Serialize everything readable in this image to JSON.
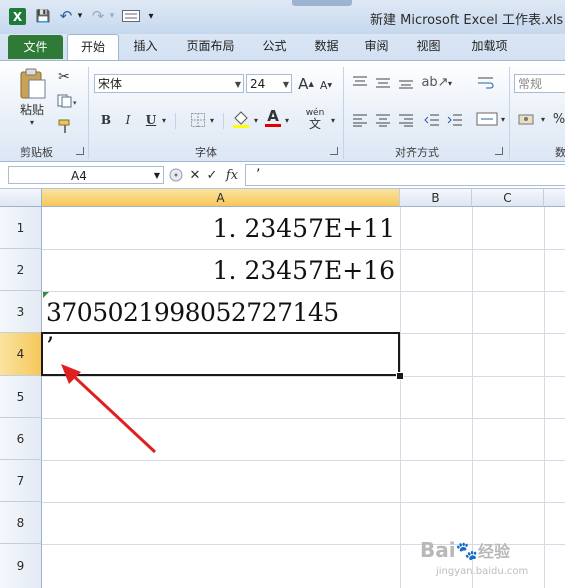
{
  "window": {
    "title": "新建 Microsoft Excel 工作表.xls  [兼",
    "app_icon": "X"
  },
  "quick_access": {
    "save_icon": "💾",
    "undo_icon": "↶",
    "redo_icon": "↷",
    "customize_icon": "▾"
  },
  "tabs": [
    {
      "label": "文件"
    },
    {
      "label": "开始"
    },
    {
      "label": "插入"
    },
    {
      "label": "页面布局"
    },
    {
      "label": "公式"
    },
    {
      "label": "数据"
    },
    {
      "label": "审阅"
    },
    {
      "label": "视图"
    },
    {
      "label": "加载项"
    }
  ],
  "ribbon": {
    "clipboard": {
      "label": "剪贴板",
      "paste_label": "粘贴"
    },
    "font": {
      "label": "字体",
      "font_name": "宋体",
      "font_size": "24",
      "bold": "B",
      "italic": "I",
      "underline": "U",
      "grow": "A",
      "shrink": "A",
      "font_color": "A",
      "wen": "wén",
      "wen_char": "文"
    },
    "alignment": {
      "label": "对齐方式"
    },
    "number": {
      "format": "常规",
      "label": "数",
      "percent": "%"
    }
  },
  "formula_bar": {
    "name_box": "A4",
    "cancel": "✕",
    "enter": "✓",
    "fx": "fx",
    "content": "’"
  },
  "columns": [
    "A",
    "B",
    "C"
  ],
  "rows": [
    "1",
    "2",
    "3",
    "4",
    "5",
    "6",
    "7",
    "8",
    "9"
  ],
  "cells": {
    "A1": "1. 23457E+11",
    "A2": "1. 23457E+16",
    "A3": "370502199805272 7145",
    "A4": "’"
  },
  "watermark": {
    "text": "Bai",
    "text2": "经验",
    "url": "jingyan.baidu.com"
  },
  "colors": {
    "file_tab": "#2f7a36",
    "annotation_arrow": "#e02020",
    "selection": "#1a1a1a"
  }
}
